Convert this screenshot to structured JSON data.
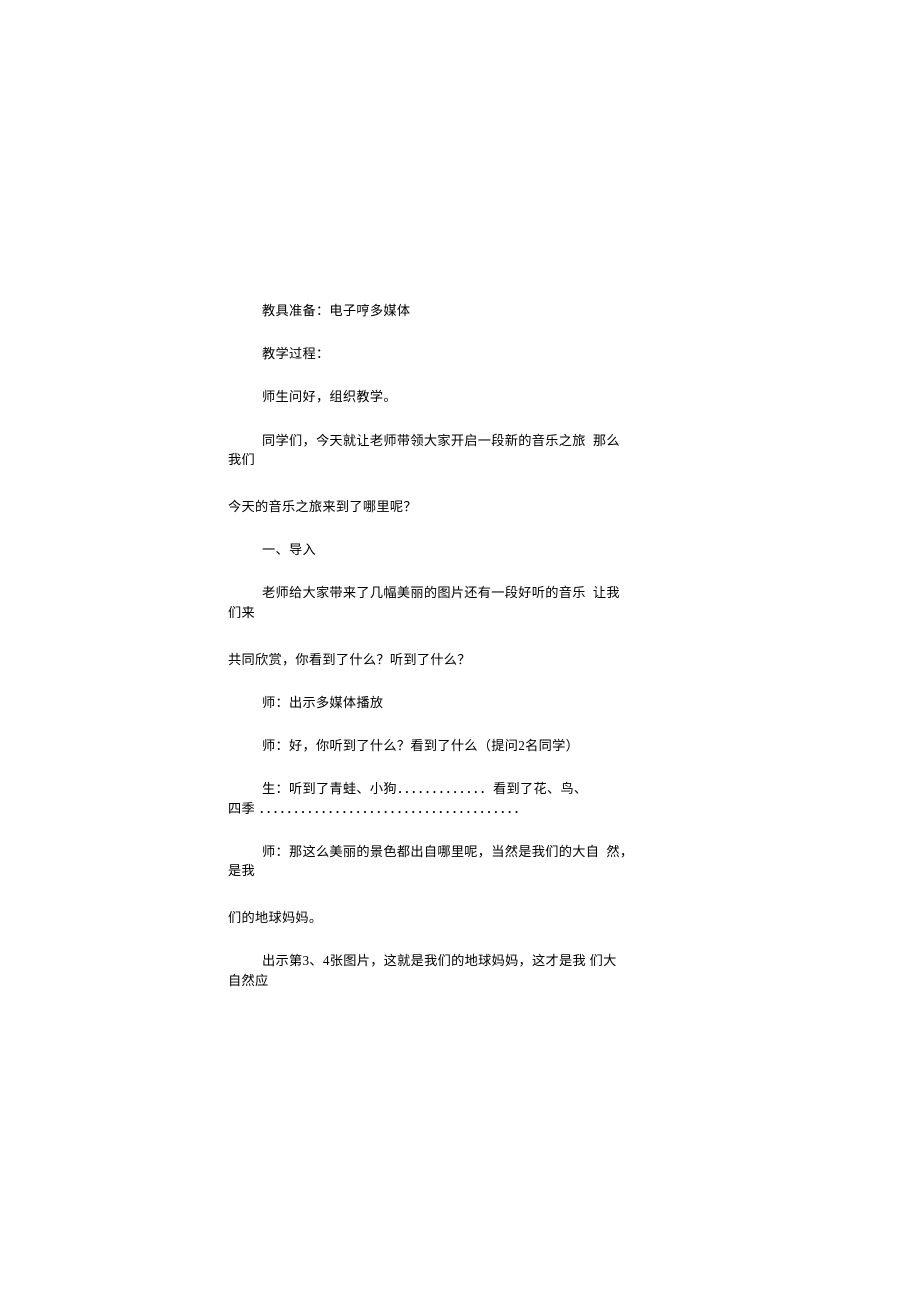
{
  "lines": {
    "l1": "教具准备：电子哼多媒体",
    "l2": "教学过程：",
    "l3": "师生问好，组织教学。",
    "l4a": "同学们，今天就让老师带领大家开启一段新的音乐之旅  那么",
    "l4b": "我们",
    "l5": "今天的音乐之旅来到了哪里呢？",
    "l6": "一、导入",
    "l7a": "老师给大家带来了几幅美丽的图片还有一段好听的音乐  让我",
    "l7b": "们来",
    "l8": "共同欣赏，你看到了什么？听到了什么？",
    "l9": "师：出示多媒体播放",
    "l10": "师：好，你听到了什么？看到了什么（提问2名同学）",
    "l11a": "生：听到了青蛙、小狗．．．．．．．．．．．．．看到了花、鸟、",
    "l11b": "四季 ．．．．．．．．．．．．．．．．．．．．．．．．．．．．．．．．．．．．．．",
    "l12a": "师：那这么美丽的景色都出自哪里呢，当然是我们的大自  然，",
    "l12b": "是我",
    "l13": "们的地球妈妈。",
    "l14a": "出示第3、4张图片，这就是我们的地球妈妈，这才是我 们大",
    "l14b": "自然应"
  }
}
